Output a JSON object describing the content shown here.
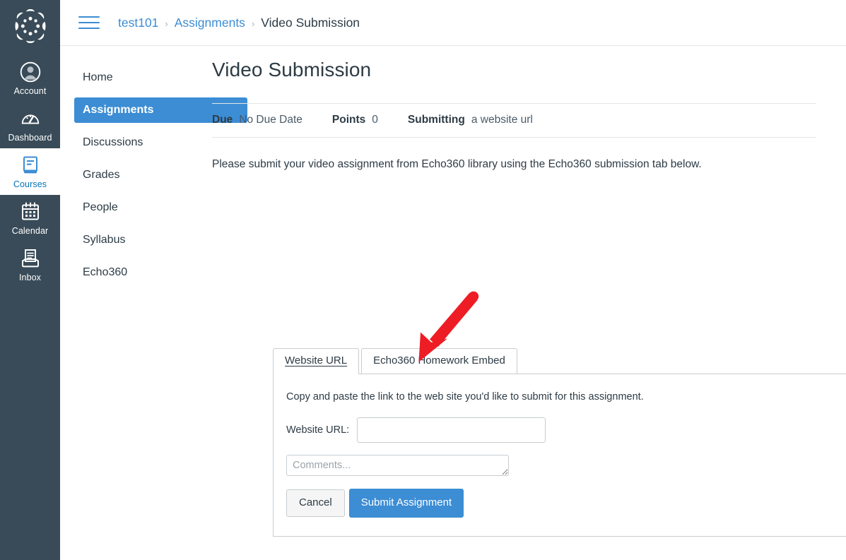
{
  "global_nav": {
    "logo": {
      "name": "canvas-logo"
    },
    "items": [
      {
        "label": "Account",
        "icon": "user-avatar-icon",
        "active": false
      },
      {
        "label": "Dashboard",
        "icon": "speedometer-icon",
        "active": false
      },
      {
        "label": "Courses",
        "icon": "book-icon",
        "active": true
      },
      {
        "label": "Calendar",
        "icon": "calendar-icon",
        "active": false
      },
      {
        "label": "Inbox",
        "icon": "inbox-tray-icon",
        "active": false
      }
    ]
  },
  "breadcrumb": {
    "menu_icon": "hamburger-menu-icon",
    "items": [
      {
        "label": "test101",
        "link": true
      },
      {
        "label": "Assignments",
        "link": true
      },
      {
        "label": "Video Submission",
        "link": false
      }
    ],
    "separator": "›"
  },
  "course_nav": {
    "items": [
      {
        "label": "Home",
        "active": false
      },
      {
        "label": "Assignments",
        "active": true
      },
      {
        "label": "Discussions",
        "active": false
      },
      {
        "label": "Grades",
        "active": false
      },
      {
        "label": "People",
        "active": false
      },
      {
        "label": "Syllabus",
        "active": false
      },
      {
        "label": "Echo360",
        "active": false
      }
    ]
  },
  "assignment": {
    "title": "Video Submission",
    "meta": {
      "due_label": "Due",
      "due_value": "No Due Date",
      "points_label": "Points",
      "points_value": "0",
      "submitting_label": "Submitting",
      "submitting_value": "a website url"
    },
    "description": "Please submit your video assignment from Echo360 library using the Echo360 submission tab below."
  },
  "submission": {
    "tabs": [
      {
        "label": "Website URL",
        "active": true
      },
      {
        "label": "Echo360 Homework Embed",
        "active": false
      }
    ],
    "instructions": "Copy and paste the link to the web site you'd like to submit for this assignment.",
    "url_field": {
      "label": "Website URL:",
      "value": "",
      "placeholder": ""
    },
    "comments_field": {
      "value": "",
      "placeholder": "Comments..."
    },
    "cancel_label": "Cancel",
    "submit_label": "Submit Assignment"
  },
  "annotation": {
    "arrow": {
      "name": "red-pointer-arrow",
      "color": "#EE1C25",
      "points_to": "Echo360 Homework Embed"
    }
  },
  "colors": {
    "global_nav_bg": "#394B58",
    "accent_blue": "#3C8DD4",
    "link_blue": "#0374B5",
    "text_dark": "#2D3B45",
    "border_gray": "#C7CDD1",
    "annotation_red": "#EE1C25"
  }
}
